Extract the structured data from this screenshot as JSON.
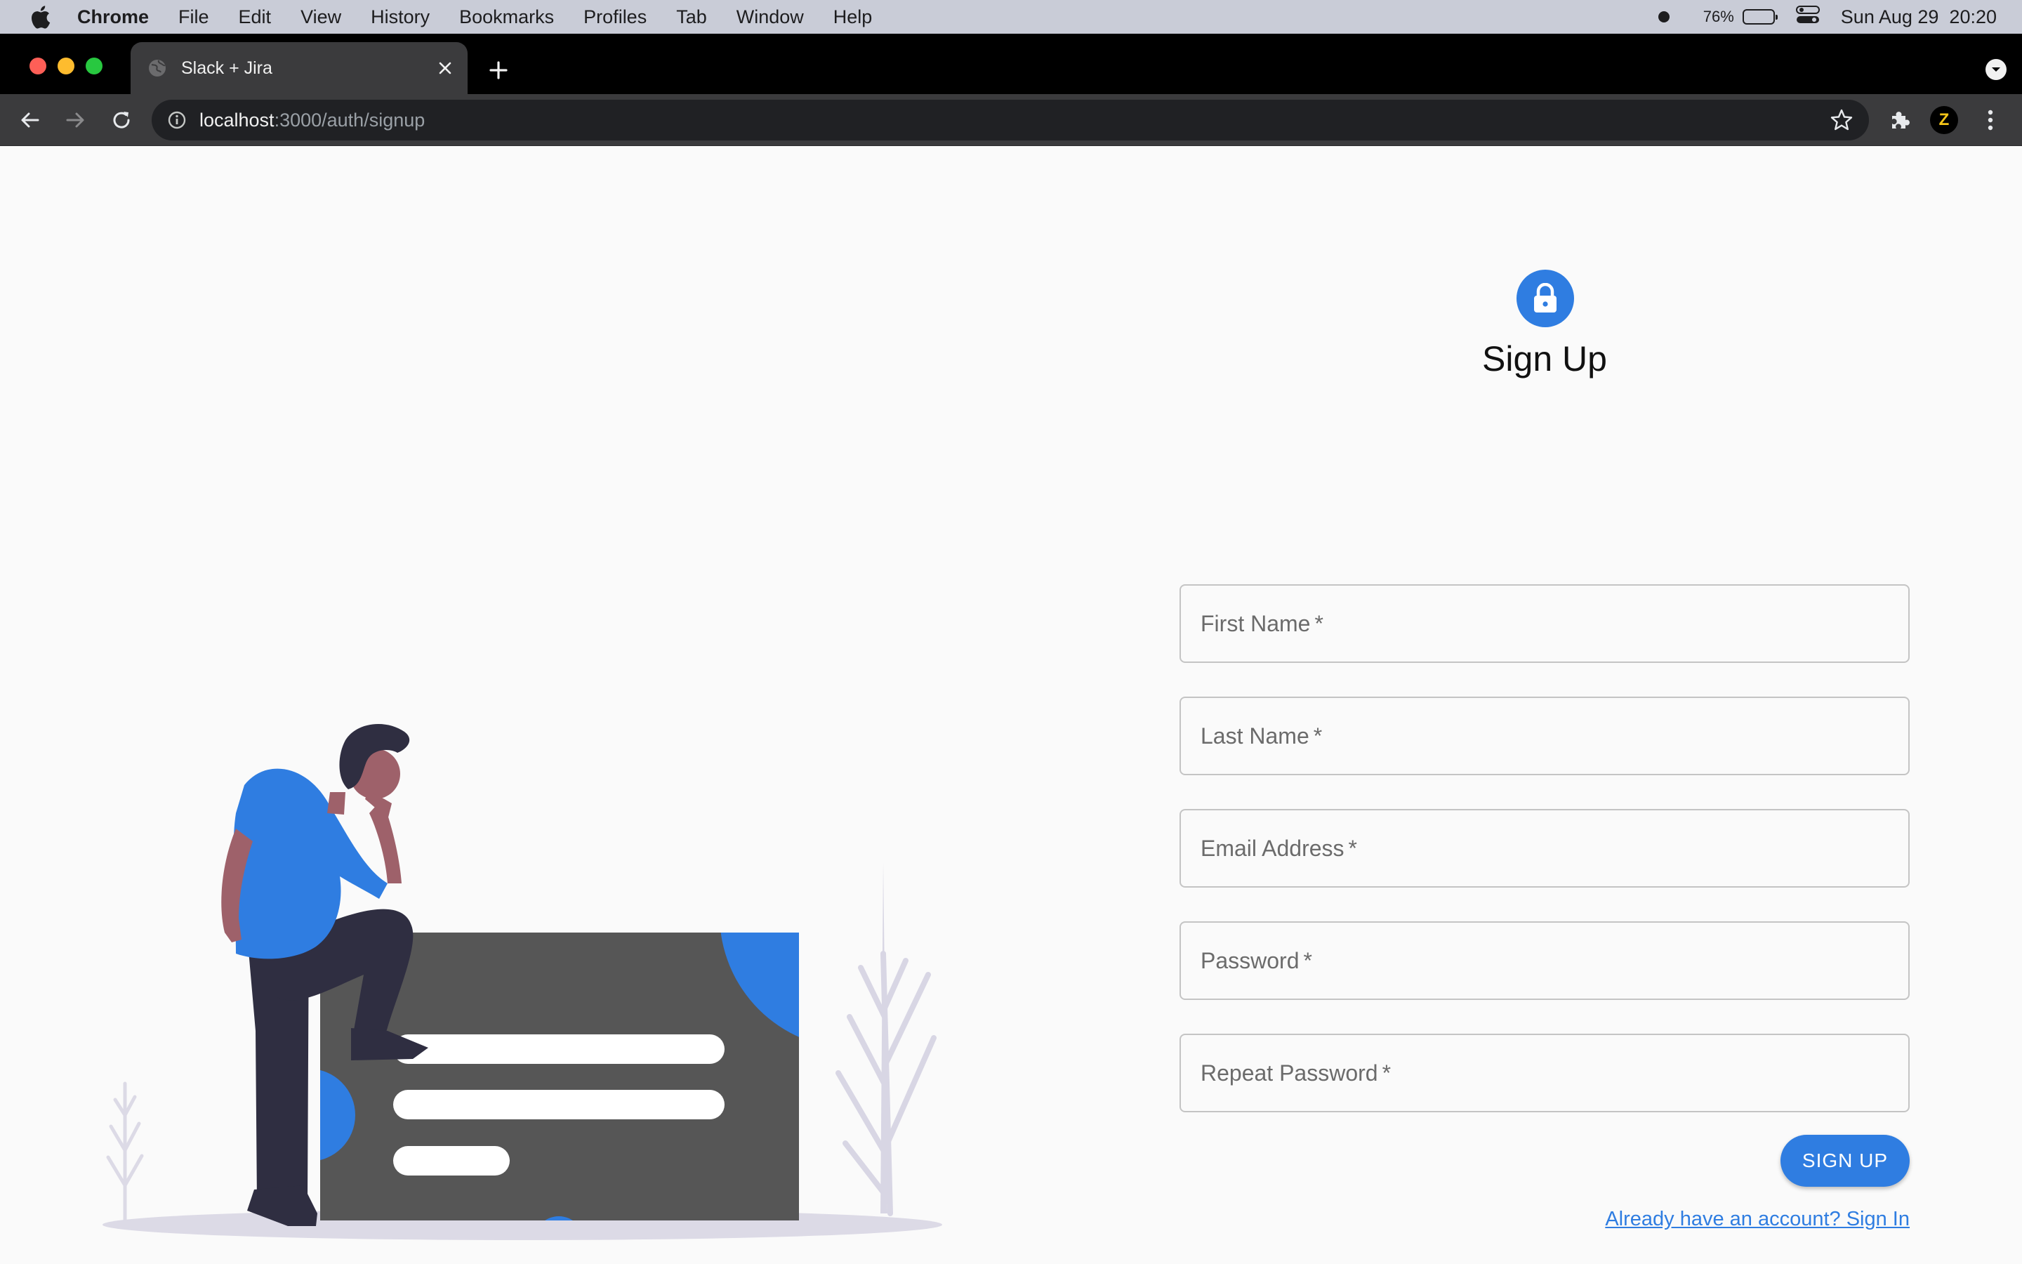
{
  "menubar": {
    "app_name": "Chrome",
    "items": [
      "File",
      "Edit",
      "View",
      "History",
      "Bookmarks",
      "Profiles",
      "Tab",
      "Window",
      "Help"
    ],
    "battery_percent": "76%",
    "battery_level": 0.76,
    "datetime": "Sun Aug 29  20:20"
  },
  "browser": {
    "tab_title": "Slack + Jira",
    "url_host": "localhost",
    "url_path": ":3000/auth/signup",
    "extension_badge": "Z"
  },
  "form": {
    "title": "Sign Up",
    "fields": [
      {
        "label": "First Name",
        "required_mark": "*"
      },
      {
        "label": "Last Name",
        "required_mark": "*"
      },
      {
        "label": "Email Address",
        "required_mark": "*"
      },
      {
        "label": "Password",
        "required_mark": "*"
      },
      {
        "label": "Repeat Password",
        "required_mark": "*"
      }
    ],
    "submit_label": "SIGN UP",
    "signin_link": "Already have an account? Sign In"
  },
  "colors": {
    "accent": "#2f7de1",
    "card": "#565656",
    "figure_dark": "#2f2e41",
    "skin": "#9e616a",
    "ground": "#dcdae6"
  },
  "icons": {
    "menubar": [
      "apple-icon",
      "record-icon",
      "battery-icon",
      "control-center-icon"
    ],
    "form_avatar": "lock-icon"
  }
}
